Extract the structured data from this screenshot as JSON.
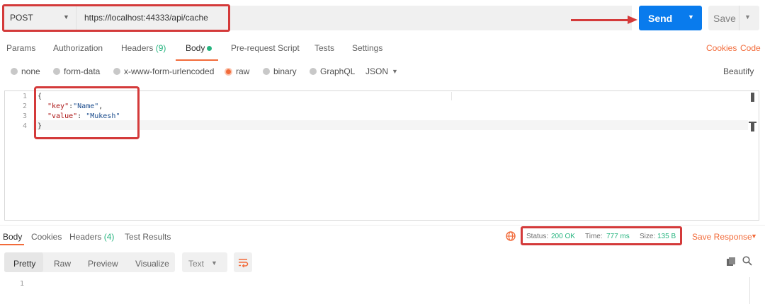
{
  "request": {
    "method": "POST",
    "url": "https://localhost:44333/api/cache",
    "send_label": "Send",
    "save_label": "Save"
  },
  "request_tabs": [
    {
      "label": "Params"
    },
    {
      "label": "Authorization"
    },
    {
      "label": "Headers",
      "count": "(9)"
    },
    {
      "label": "Body"
    },
    {
      "label": "Pre-request Script"
    },
    {
      "label": "Tests"
    },
    {
      "label": "Settings"
    }
  ],
  "links": {
    "cookies": "Cookies",
    "code": "Code",
    "beautify": "Beautify"
  },
  "body_types": [
    "none",
    "form-data",
    "x-www-form-urlencoded",
    "raw",
    "binary",
    "GraphQL"
  ],
  "raw_format": "JSON",
  "editor": {
    "line_numbers": [
      "1",
      "2",
      "3",
      "4"
    ],
    "line1": "{",
    "line2_key": "\"key\"",
    "line2_sep": ":",
    "line2_val": "\"Name\"",
    "line2_end": ",",
    "line3_key": "\"value\"",
    "line3_sep": ": ",
    "line3_val": "\"Mukesh\"",
    "line4": "}"
  },
  "response_tabs": [
    {
      "label": "Body"
    },
    {
      "label": "Cookies"
    },
    {
      "label": "Headers",
      "count": "(4)"
    },
    {
      "label": "Test Results"
    }
  ],
  "status": {
    "status_label": "Status:",
    "status_value": "200 OK",
    "time_label": "Time:",
    "time_value": "777 ms",
    "size_label": "Size:",
    "size_value": "135 B"
  },
  "save_response": "Save Response",
  "view_modes": [
    "Pretty",
    "Raw",
    "Preview",
    "Visualize"
  ],
  "view_format": "Text",
  "response_line_number": "1",
  "colors": {
    "send": "#097bed",
    "accent": "#f26b3a",
    "success": "#26b47f",
    "highlight": "#d43a3a"
  }
}
